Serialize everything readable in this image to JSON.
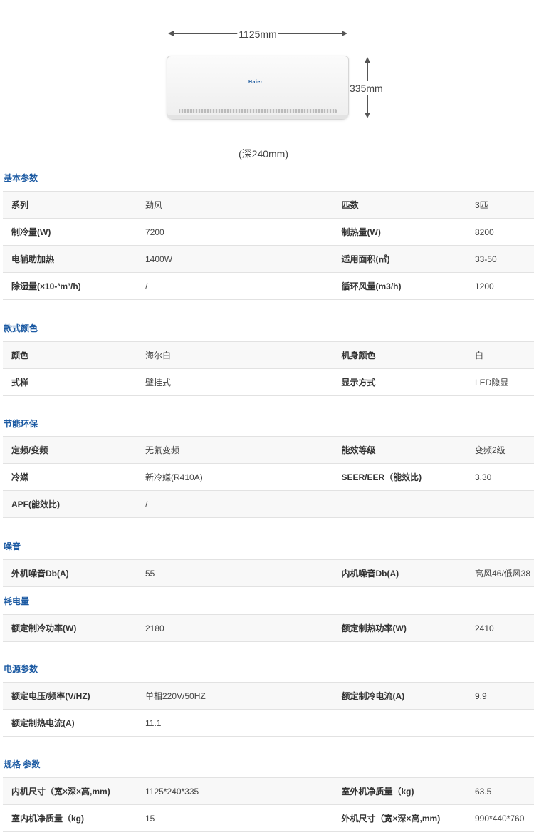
{
  "diagram": {
    "width_label": "1125mm",
    "height_label": "335mm",
    "depth_label": "(深240mm)",
    "brand_logo": "Haier"
  },
  "sections": [
    {
      "title": "基本参数",
      "rows": [
        [
          "系列",
          "劲风",
          "匹数",
          "3匹"
        ],
        [
          "制冷量(W)",
          "7200",
          "制热量(W)",
          "8200"
        ],
        [
          "电辅助加热",
          "1400W",
          "适用面积(㎡)",
          "33-50"
        ],
        [
          "除湿量(×10-³m³/h)",
          "/",
          "循环风量(m3/h)",
          "1200"
        ]
      ]
    },
    {
      "title": "款式颜色",
      "rows": [
        [
          "颜色",
          "海尔白",
          "机身颜色",
          "白"
        ],
        [
          "式样",
          "壁挂式",
          "显示方式",
          "LED隐显"
        ]
      ]
    },
    {
      "title": "节能环保",
      "rows": [
        [
          "定频/变频",
          "无氟变频",
          "能效等级",
          "变频2级"
        ],
        [
          "冷媒",
          "新冷媒(R410A)",
          "SEER/EER（能效比)",
          "3.30"
        ],
        [
          "APF(能效比)",
          "/",
          "",
          ""
        ]
      ]
    },
    {
      "title": "噪音",
      "rows": [
        [
          "外机噪音Db(A)",
          "55",
          "内机噪音Db(A)",
          "高风46/低风38"
        ]
      ]
    },
    {
      "title": "耗电量",
      "rows": [
        [
          "额定制冷功率(W)",
          "2180",
          "额定制热功率(W)",
          "2410"
        ]
      ]
    },
    {
      "title": "电源参数",
      "rows": [
        [
          "额定电压/频率(V/HZ)",
          "单相220V/50HZ",
          "额定制冷电流(A)",
          "9.9"
        ],
        [
          "额定制热电流(A)",
          "11.1",
          "",
          ""
        ]
      ]
    },
    {
      "title": "规格 参数",
      "rows": [
        [
          "内机尺寸（宽×深×高,mm)",
          "1125*240*335",
          "室外机净质量（kg)",
          "63.5"
        ],
        [
          "室内机净质量（kg)",
          "15",
          "外机尺寸（宽×深×高,mm)",
          "990*440*760"
        ]
      ]
    }
  ]
}
